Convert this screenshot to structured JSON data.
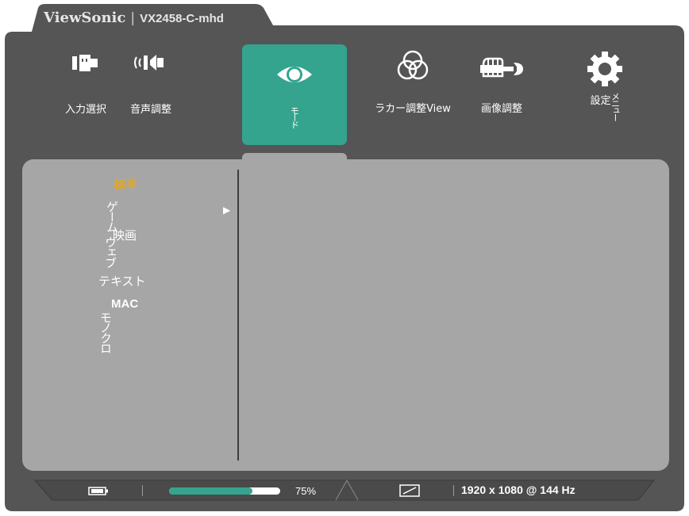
{
  "brand": {
    "logo": "ViewSonic",
    "separator": "|",
    "model": "VX2458-C-mhd"
  },
  "nav": [
    {
      "label": "入力選択",
      "icon": "input-select-icon",
      "active": false
    },
    {
      "label": "音声調整",
      "icon": "speaker-icon",
      "active": false
    },
    {
      "label": "モード",
      "icon": "eye-icon",
      "active": true
    },
    {
      "label": "ラカー調整View",
      "icon": "color-circles-icon",
      "active": false
    },
    {
      "label": "画像調整",
      "icon": "hand-wrench-icon",
      "active": false
    },
    {
      "label": "設定",
      "label_vertical": "メニュー",
      "icon": "gear-icon",
      "active": false
    }
  ],
  "menu": {
    "items": [
      {
        "label": "標準",
        "selected": true
      },
      {
        "label": "ゲーム",
        "vertical": true,
        "has_submenu": true
      },
      {
        "label": "映画"
      },
      {
        "label": "ウェブ",
        "vertical": true
      },
      {
        "label": "テキスト"
      },
      {
        "label": "MAC"
      },
      {
        "label": "モノクロ",
        "vertical": true
      }
    ],
    "submenu_arrow": "▶"
  },
  "status": {
    "progress_percent": 75,
    "progress_label": "75%",
    "resolution": "1920 x 1080 @ 144 Hz"
  },
  "colors": {
    "frame": "#555555",
    "accent": "#34a48e",
    "panel": "#a6a6a6",
    "selected_text": "#f2a900",
    "status_bar": "#4a4a4a"
  }
}
